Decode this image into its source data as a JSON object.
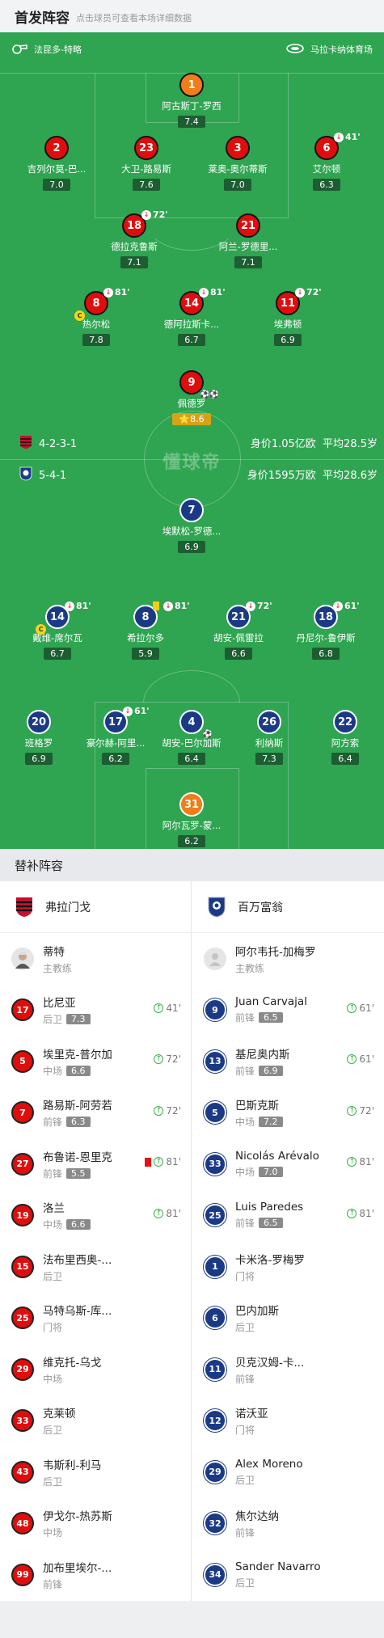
{
  "header": {
    "title": "首发阵容",
    "subtitle": "点击球员可查看本场详细数据"
  },
  "pitch_info": {
    "referee": "法昆多-特略",
    "stadium": "马拉卡纳体育场"
  },
  "watermark": "懂球帝",
  "home": {
    "formation": "4-2-3-1",
    "value": "身价1.05亿欧",
    "age": "平均28.5岁"
  },
  "away": {
    "formation": "5-4-1",
    "value": "身价1595万欧",
    "age": "平均28.6岁"
  },
  "home_players": [
    {
      "num": "1",
      "name": "阿古斯丁-罗西",
      "rating": "7.4"
    },
    {
      "num": "2",
      "name": "吉列尔莫-巴...",
      "rating": "7.0"
    },
    {
      "num": "23",
      "name": "大卫-路易斯",
      "rating": "7.6"
    },
    {
      "num": "3",
      "name": "莱奥-奥尔蒂斯",
      "rating": "7.0"
    },
    {
      "num": "6",
      "name": "艾尔顿",
      "rating": "6.3",
      "sub": "41'"
    },
    {
      "num": "18",
      "name": "德拉克鲁斯",
      "rating": "7.1",
      "sub": "72'"
    },
    {
      "num": "21",
      "name": "阿兰-罗德里...",
      "rating": "7.1"
    },
    {
      "num": "8",
      "name": "热尔松",
      "rating": "7.8",
      "sub": "81'",
      "captain": "C"
    },
    {
      "num": "14",
      "name": "德阿拉斯卡...",
      "rating": "6.7",
      "sub": "81'"
    },
    {
      "num": "11",
      "name": "埃弗顿",
      "rating": "6.9",
      "sub": "72'"
    },
    {
      "num": "9",
      "name": "佩德罗",
      "rating": "8.6",
      "goals": "⚽⚽",
      "star": "⭐"
    }
  ],
  "away_players": [
    {
      "num": "7",
      "name": "埃默松-罗德...",
      "rating": "6.9"
    },
    {
      "num": "14",
      "name": "戴维-席尔瓦",
      "rating": "6.7",
      "sub": "81'",
      "captain": "C"
    },
    {
      "num": "8",
      "name": "希拉尔多",
      "rating": "5.9",
      "sub": "81'"
    },
    {
      "num": "21",
      "name": "胡安-佩雷拉",
      "rating": "6.6",
      "sub": "72'"
    },
    {
      "num": "18",
      "name": "丹尼尔-鲁伊斯",
      "rating": "6.8",
      "sub": "61'"
    },
    {
      "num": "20",
      "name": "班格罗",
      "rating": "6.9"
    },
    {
      "num": "17",
      "name": "豪尔赫-阿里...",
      "rating": "6.2",
      "sub": "61'"
    },
    {
      "num": "4",
      "name": "胡安-巴尔加斯",
      "rating": "6.4",
      "owngoal": "⚽"
    },
    {
      "num": "26",
      "name": "利纳斯",
      "rating": "7.3"
    },
    {
      "num": "22",
      "name": "阿方索",
      "rating": "6.4"
    },
    {
      "num": "31",
      "name": "阿尔瓦罗-蒙...",
      "rating": "6.2"
    }
  ],
  "subs_header": "替补阵容",
  "home_bench": {
    "team": "弗拉门戈",
    "coach": {
      "name": "蒂特",
      "role": "主教练"
    },
    "subs": [
      {
        "num": "17",
        "name": "比尼亚",
        "pos": "后卫",
        "rating": "7.3",
        "on": "41'"
      },
      {
        "num": "5",
        "name": "埃里克-普尔加",
        "pos": "中场",
        "rating": "6.6",
        "on": "72'"
      },
      {
        "num": "7",
        "name": "路易斯-阿劳若",
        "pos": "前锋",
        "rating": "6.3",
        "on": "72'"
      },
      {
        "num": "27",
        "name": "布鲁诺-恩里克",
        "pos": "前锋",
        "rating": "5.5",
        "on": "81'",
        "red": true
      },
      {
        "num": "19",
        "name": "洛兰",
        "pos": "中场",
        "rating": "6.6",
        "on": "81'"
      },
      {
        "num": "15",
        "name": "法布里西奥-...",
        "pos": "后卫"
      },
      {
        "num": "25",
        "name": "马特乌斯-库...",
        "pos": "门将"
      },
      {
        "num": "29",
        "name": "维克托-乌戈",
        "pos": "中场"
      },
      {
        "num": "33",
        "name": "克莱顿",
        "pos": "后卫"
      },
      {
        "num": "43",
        "name": "韦斯利-利马",
        "pos": "后卫"
      },
      {
        "num": "48",
        "name": "伊戈尔-热苏斯",
        "pos": "中场"
      },
      {
        "num": "99",
        "name": "加布里埃尔-...",
        "pos": "前锋"
      }
    ]
  },
  "away_bench": {
    "team": "百万富翁",
    "coach": {
      "name": "阿尔韦托-加梅罗",
      "role": "主教练"
    },
    "subs": [
      {
        "num": "9",
        "name": "Juan Carvajal",
        "pos": "前锋",
        "rating": "6.5",
        "on": "61'"
      },
      {
        "num": "13",
        "name": "基尼奥内斯",
        "pos": "前锋",
        "rating": "6.9",
        "on": "61'"
      },
      {
        "num": "5",
        "name": "巴斯克斯",
        "pos": "中场",
        "rating": "7.2",
        "on": "72'"
      },
      {
        "num": "33",
        "name": "Nicolás Arévalo",
        "pos": "中场",
        "rating": "7.0",
        "on": "81'"
      },
      {
        "num": "25",
        "name": "Luis Paredes",
        "pos": "前锋",
        "rating": "6.5",
        "on": "81'"
      },
      {
        "num": "1",
        "name": "卡米洛-罗梅罗",
        "pos": "门将"
      },
      {
        "num": "6",
        "name": "巴内加斯",
        "pos": "后卫"
      },
      {
        "num": "11",
        "name": "贝克汉姆-卡...",
        "pos": "前锋"
      },
      {
        "num": "12",
        "name": "诺沃亚",
        "pos": "门将"
      },
      {
        "num": "29",
        "name": "Alex Moreno",
        "pos": "后卫"
      },
      {
        "num": "32",
        "name": "焦尔达纳",
        "pos": "前锋"
      },
      {
        "num": "34",
        "name": "Sander Navarro",
        "pos": "后卫"
      }
    ]
  }
}
